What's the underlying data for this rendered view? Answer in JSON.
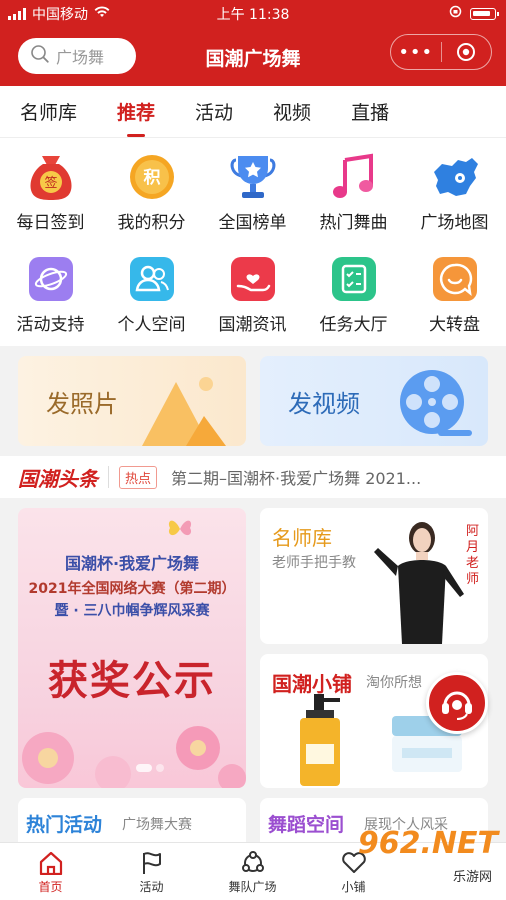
{
  "status_bar": {
    "carrier": "中国移动",
    "time": "上午 11:38"
  },
  "header": {
    "search_placeholder": "广场舞",
    "title": "国潮广场舞",
    "menu_label": "•••"
  },
  "tabs": [
    {
      "label": "名师库",
      "active": false
    },
    {
      "label": "推荐",
      "active": true
    },
    {
      "label": "活动",
      "active": false
    },
    {
      "label": "视频",
      "active": false
    },
    {
      "label": "直播",
      "active": false
    }
  ],
  "grid": {
    "row1": [
      {
        "label": "每日签到",
        "icon": "sign-in-bag-icon",
        "badge": "签"
      },
      {
        "label": "我的积分",
        "icon": "points-coin-icon",
        "badge": "积"
      },
      {
        "label": "全国榜单",
        "icon": "trophy-icon"
      },
      {
        "label": "热门舞曲",
        "icon": "music-note-icon"
      },
      {
        "label": "广场地图",
        "icon": "china-map-icon"
      }
    ],
    "row2": [
      {
        "label": "活动支持",
        "icon": "planet-icon"
      },
      {
        "label": "个人空间",
        "icon": "people-icon"
      },
      {
        "label": "国潮资讯",
        "icon": "hand-heart-icon"
      },
      {
        "label": "任务大厅",
        "icon": "task-list-icon"
      },
      {
        "label": "大转盘",
        "icon": "smile-chat-icon"
      }
    ]
  },
  "promo": {
    "photo_label": "发照片",
    "video_label": "发视频"
  },
  "headline": {
    "logo": "国潮头条",
    "tag": "热点",
    "text": "第二期–国潮杯·我爱广场舞 2021..."
  },
  "banner": {
    "line1": "国潮杯·我爱广场舞",
    "line2": "2021年全国网络大赛（第二期）",
    "line3": "暨 · 三八巾帼争辉风采赛",
    "line4": "获奖公示"
  },
  "cards": {
    "teacher": {
      "title": "名师库",
      "subtitle": "老师手把手教",
      "tag": "阿月老师"
    },
    "shop": {
      "title": "国潮小铺",
      "subtitle": "淘你所想"
    },
    "hot": {
      "title": "热门活动",
      "subtitle": "广场舞大赛"
    },
    "space": {
      "title": "舞蹈空间",
      "subtitle": "展现个人风采"
    }
  },
  "nav": [
    {
      "label": "首页",
      "icon": "home-icon",
      "active": true
    },
    {
      "label": "活动",
      "icon": "flag-icon",
      "active": false
    },
    {
      "label": "舞队广场",
      "icon": "team-icon",
      "active": false
    },
    {
      "label": "小铺",
      "icon": "heart-icon",
      "active": false
    }
  ],
  "watermark": {
    "logo": "962.NET",
    "sub": "乐游网"
  },
  "colors": {
    "brand": "#d1211f"
  }
}
